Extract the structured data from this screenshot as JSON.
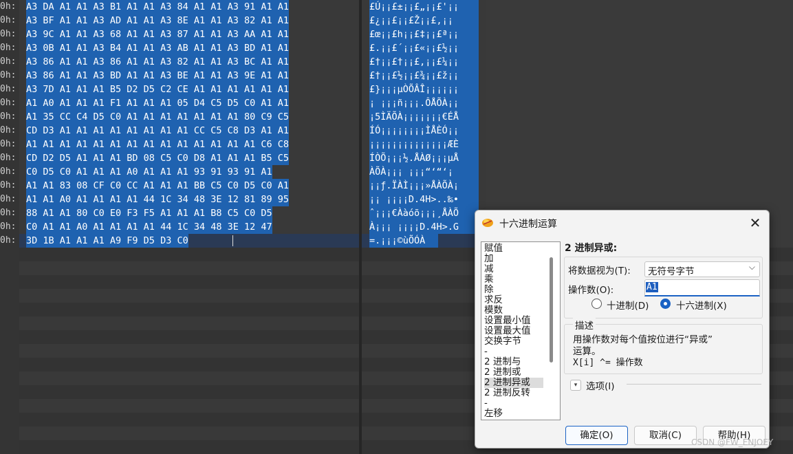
{
  "offsets": [
    "0h:",
    "0h:",
    "0h:",
    "0h:",
    "0h:",
    "0h:",
    "0h:",
    "0h:",
    "0h:",
    "0h:",
    "0h:",
    "0h:",
    "0h:",
    "0h:",
    "0h:",
    "0h:",
    "0h:",
    "0h:"
  ],
  "hex_rows": [
    "A3 DA A1 A1 A3 B1 A1 A1 A3 84 A1 A1 A3 91 A1 A1",
    "A3 BF A1 A1 A3 AD A1 A1 A3 8E A1 A1 A3 82 A1 A1",
    "A3 9C A1 A1 A3 68 A1 A1 A3 87 A1 A1 A3 AA A1 A1",
    "A3 0B A1 A1 A3 B4 A1 A1 A3 AB A1 A1 A3 BD A1 A1",
    "A3 86 A1 A1 A3 86 A1 A1 A3 82 A1 A1 A3 BC A1 A1",
    "A3 86 A1 A1 A3 BD A1 A1 A3 BE A1 A1 A3 9E A1 A1",
    "A3 7D A1 A1 A1 B5 D2 D5 C2 CE A1 A1 A1 A1 A1 A1",
    "A1 A0 A1 A1 A1 F1 A1 A1 A1 05 D4 C5 D5 C0 A1 A1",
    "A1 35 CC C4 D5 C0 A1 A1 A1 A1 A1 A1 A1 80 C9 C5",
    "CD D3 A1 A1 A1 A1 A1 A1 A1 A1 CC C5 C8 D3 A1 A1",
    "A1 A1 A1 A1 A1 A1 A1 A1 A1 A1 A1 A1 A1 A1 C6 C8",
    "CD D2 D5 A1 A1 A1 BD 08 C5 C0 D8 A1 A1 A1 B5 C5",
    "C0 D5 C0 A1 A1 A1 A0 A1 A1 A1 93 91 93 91 A1",
    "A1 A1 83 08 CF C0 CC A1 A1 A1 BB C5 C0 D5 C0 A1",
    "A1 A1 A0 A1 A1 A1 A1 44 1C 34 48 3E 12 81 89 95",
    "88 A1 A1 80 C0 E0 F3 F5 A1 A1 A1 B8 C5 C0 D5",
    "C0 A1 A1 A0 A1 A1 A1 A1 44 1C 34 48 3E 12 47",
    "3D 1B A1 A1 A1 A9 F9 D5 D3 C0"
  ],
  "text_rows": [
    "£Ú¡¡£±¡¡£„¡¡£'¡¡",
    "£¿¡¡£­¡¡£Ž¡¡£‚¡¡",
    "£œ¡¡£h¡¡£‡¡¡£ª¡¡",
    "£.¡¡£´¡¡£«¡¡£½¡¡",
    "£†¡¡£†¡¡£‚¡¡£¼¡¡",
    "£†¡¡£½¡¡£¾¡¡£ž¡¡",
    "£}¡¡¡µÒÕÂÎ¡¡¡¡¡¡",
    "¡ ¡¡¡ñ¡¡¡.ÔÅÕÀ¡¡",
    "¡5ÌÄÕÀ¡¡¡¡¡¡¡€ÉÅ",
    "ÍÓ¡¡¡¡¡¡¡¡ÌÅÈÓ¡¡",
    "¡¡¡¡¡¡¡¡¡¡¡¡¡¡ÆÈ",
    "ÍÒÕ¡¡¡½.ÅÀØ¡¡¡µÅ",
    "ÀÕÀ¡¡¡ ¡¡¡“‘“‘¡",
    "¡¡ƒ.ÏÀÌ¡¡¡»ÅÀÕÀ¡",
    "¡¡ ¡¡¡¡D.4H>..‰•",
    "ˆ¡¡¡€Ààóõ¡¡¡¸ÅÀÕ",
    "À¡¡¡ ¡¡¡¡D.4H>.G",
    "=.¡¡¡©ùÕÓÀ"
  ],
  "dialog": {
    "title": "十六进制运算",
    "close_glyph": "✕",
    "operations": [
      "赋值",
      "加",
      "减",
      "乘",
      "除",
      "求反",
      "模数",
      "设置最小值",
      "设置最大值",
      "交换字节",
      "-",
      "2 进制与",
      "2 进制或",
      "2 进制异或",
      "2 进制反转",
      "-",
      "左移"
    ],
    "selected_operation": "2 进制异或",
    "operation_title": "2 进制异或:",
    "treat_as_label": "将数据视为(T):",
    "treat_as_value": "无符号字节",
    "operand_label": "操作数(O):",
    "operand_value": "A1",
    "radio_decimal": "十进制(D)",
    "radio_hex": "十六进制(X)",
    "radio_selected": "hex",
    "desc_title": "描述",
    "desc_line1": "用操作数对每个值按位进行“异或”",
    "desc_line2": "运算。",
    "desc_line3": "X[i] ^= 操作数",
    "options_label": "选项(I)",
    "ok_label": "确定(O)",
    "cancel_label": "取消(C)",
    "help_label": "帮助(H)"
  },
  "watermark": "CSDN @FW_ENJOEY"
}
